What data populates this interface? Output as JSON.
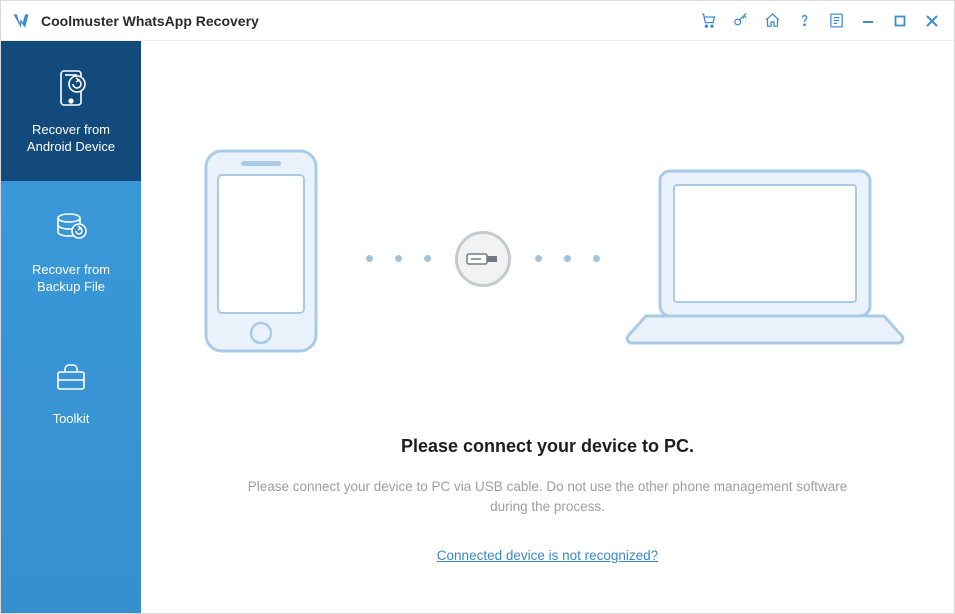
{
  "app": {
    "title": "Coolmuster WhatsApp Recovery"
  },
  "sidebar": {
    "items": [
      {
        "label": "Recover from\nAndroid Device"
      },
      {
        "label": "Recover from\nBackup File"
      },
      {
        "label": "Toolkit"
      }
    ]
  },
  "content": {
    "headline": "Please connect your device to PC.",
    "subline": "Please connect your device to PC via USB cable. Do not use the other phone management software during the process.",
    "link": "Connected device is not recognized?"
  }
}
